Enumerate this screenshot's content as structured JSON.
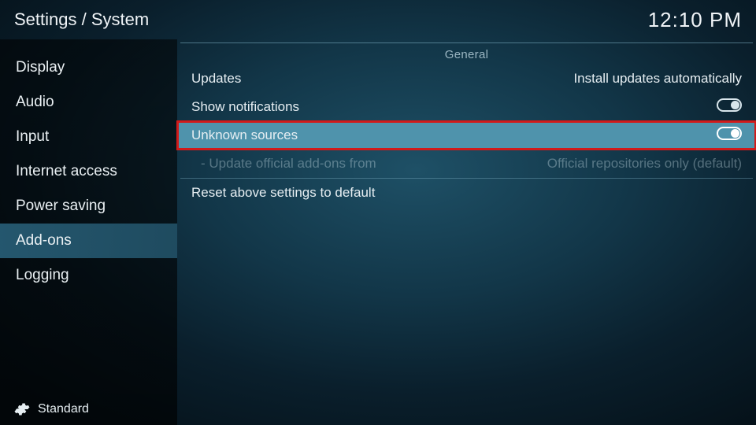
{
  "header": {
    "breadcrumb": "Settings / System",
    "clock": "12:10 PM"
  },
  "sidebar": {
    "items": [
      {
        "label": "Display"
      },
      {
        "label": "Audio"
      },
      {
        "label": "Input"
      },
      {
        "label": "Internet access"
      },
      {
        "label": "Power saving"
      },
      {
        "label": "Add-ons"
      },
      {
        "label": "Logging"
      }
    ],
    "footer_label": "Standard"
  },
  "content": {
    "section_title": "General",
    "updates": {
      "label": "Updates",
      "value": "Install updates automatically"
    },
    "show_notifications": {
      "label": "Show notifications"
    },
    "unknown_sources": {
      "label": "Unknown sources"
    },
    "update_official": {
      "label": "- Update official add-ons from",
      "value": "Official repositories only (default)"
    },
    "reset": {
      "label": "Reset above settings to default"
    }
  }
}
